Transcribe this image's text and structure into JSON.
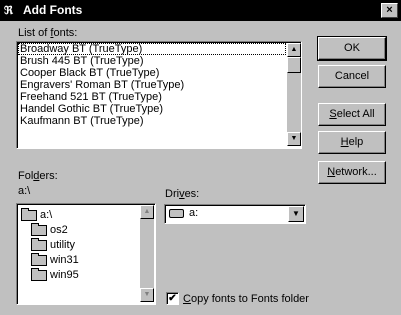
{
  "window": {
    "title": "Add Fonts",
    "close_glyph": "×",
    "app_icon": "fonts-icon"
  },
  "fonts": {
    "label_pre": "List of ",
    "label_u": "f",
    "label_post": "onts:",
    "items": [
      "Broadway BT (TrueType)",
      "Brush 445 BT (TrueType)",
      "Cooper Black BT (TrueType)",
      "Engravers' Roman BT (TrueType)",
      "Freehand 521 BT (TrueType)",
      "Handel Gothic BT (TrueType)",
      "Kaufmann BT (TrueType)"
    ],
    "selected_index": 0
  },
  "buttons": {
    "ok": "OK",
    "cancel": "Cancel",
    "select_all_u": "S",
    "select_all_rest": "elect All",
    "help_u": "H",
    "help_rest": "elp",
    "network_u": "N",
    "network_rest": "etwork..."
  },
  "folders": {
    "label_pre": "Fol",
    "label_u": "d",
    "label_post": "ers:",
    "current_path": "a:\\",
    "items": [
      {
        "name": "a:\\",
        "icon": "open-folder-icon"
      },
      {
        "name": "os2",
        "icon": "folder-icon"
      },
      {
        "name": "utility",
        "icon": "folder-icon"
      },
      {
        "name": "win31",
        "icon": "folder-icon"
      },
      {
        "name": "win95",
        "icon": "folder-icon"
      }
    ]
  },
  "drives": {
    "label_pre": "Dri",
    "label_u": "v",
    "label_post": "es:",
    "selected": "a:",
    "icon": "floppy-drive-icon"
  },
  "copy_option": {
    "checked": true,
    "check_glyph": "✔",
    "label_u": "C",
    "label_rest": "opy fonts to Fonts folder"
  },
  "colors": {
    "title_bar": "#000000",
    "dialog_face": "#c0c0c0"
  }
}
